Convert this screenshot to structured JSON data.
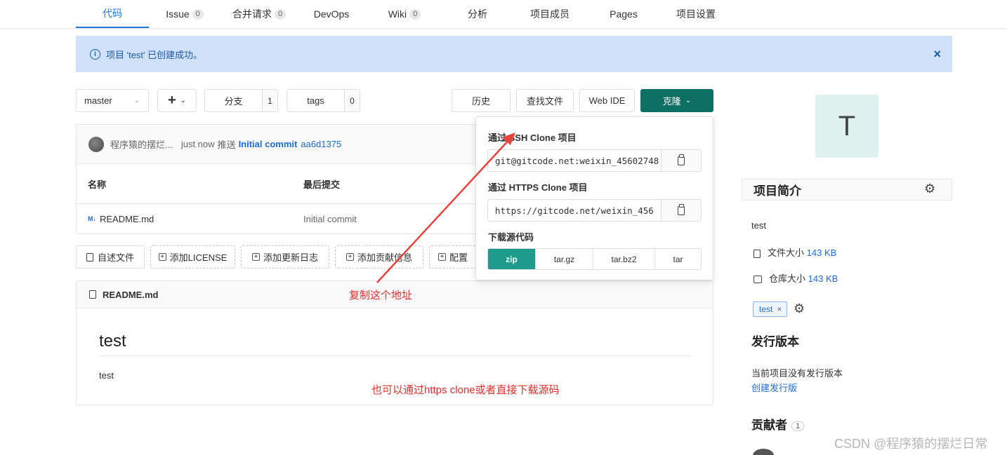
{
  "nav": {
    "tabs": [
      {
        "label": "代码",
        "count": null,
        "active": true
      },
      {
        "label": "Issue",
        "count": "0"
      },
      {
        "label": "合并请求",
        "count": "0"
      },
      {
        "label": "DevOps",
        "count": null
      },
      {
        "label": "Wiki",
        "count": "0"
      },
      {
        "label": "分析",
        "count": null
      },
      {
        "label": "项目成员",
        "count": null
      },
      {
        "label": "Pages",
        "count": null
      },
      {
        "label": "项目设置",
        "count": null
      }
    ]
  },
  "alert": {
    "icon": "info-icon",
    "text": "项目 'test' 已创建成功。",
    "close": "×"
  },
  "toolbar": {
    "branch": "master",
    "add": "+",
    "branches_label": "分支",
    "branches_count": "1",
    "tags_label": "tags",
    "tags_count": "0",
    "history": "历史",
    "find_file": "查找文件",
    "web_ide": "Web IDE",
    "clone": "克隆"
  },
  "commit": {
    "author": "程序猿的摆烂...",
    "time": "just now",
    "action": "推送",
    "message": "Initial commit",
    "sha": "aa6d1375"
  },
  "files": {
    "col_name": "名称",
    "col_last_commit": "最后提交",
    "rows": [
      {
        "icon": "M↓",
        "name": "README.md",
        "commit": "Initial commit"
      }
    ]
  },
  "actions": {
    "readme": "自述文件",
    "license": "添加LICENSE",
    "changelog": "添加更新日志",
    "contributing": "添加贡献信息",
    "config": "配置"
  },
  "readme": {
    "file": "README.md",
    "title": "test",
    "body": "test"
  },
  "clone_dropdown": {
    "ssh_label": "通过 SSH Clone 项目",
    "ssh_url": "git@gitcode.net:weixin_45602748",
    "https_label": "通过 HTTPS Clone 项目",
    "https_url": "https://gitcode.net/weixin_456",
    "download_label": "下载源代码",
    "formats": [
      "zip",
      "tar.gz",
      "tar.bz2",
      "tar"
    ]
  },
  "sidebar": {
    "avatar_letter": "T",
    "about_title": "项目简介",
    "description": "test",
    "file_size_label": "文件大小",
    "file_size": "143 KB",
    "repo_size_label": "仓库大小",
    "repo_size": "143 KB",
    "topic": "test",
    "topic_remove": "×",
    "releases_title": "发行版本",
    "no_releases": "当前项目没有发行版本",
    "create_release": "创建发行版",
    "contributors_title": "贡献者",
    "contributors_count": "1"
  },
  "annotations": {
    "copy_address": "复制这个地址",
    "https_hint": "也可以通过https clone或者直接下载源码"
  },
  "watermark": "CSDN @程序猿的摆烂日常",
  "colors": {
    "accent": "#1f7ae0",
    "clone_button": "#0e6f63",
    "zip_selected": "#1e9b8a",
    "annotation": "#e0302b",
    "alert_bg": "#cfe2f9"
  }
}
